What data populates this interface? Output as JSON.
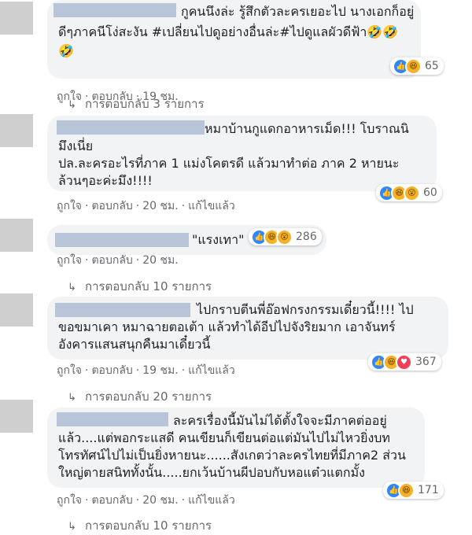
{
  "comments": [
    {
      "lines": [
        "กูคนนึงล่ะ รู้สึกตัวละครเยอะไป นางเอกก็อยู่",
        "ดีๆภาคนีโง่สะงัน #เปลี่ยนไปดูอย่างอื่นล่ะ#ไปดูแลผัวดีฟ้า🤣🤣",
        "🤣"
      ],
      "reaction_count": "65",
      "reactions": [
        "like-icon",
        "haha-icon"
      ],
      "like": "ถูกใจ",
      "reply": "ตอบกลับ",
      "time": "19 ชม.",
      "edited": "",
      "replies_label": "การตอบกลับ 3 รายการ"
    },
    {
      "lines": [
        "หมาบ้านกูแดกอาหารเม็ด!!! โบราณนิ",
        "มึงเนี่ย",
        "ปล.ละครอะไรที่ภาค 1 แม่งโคตรดี แล้วมาทำต่อ ภาค 2 หายนะ",
        "ล้วนๆอะค่ะมึง!!!!"
      ],
      "reaction_count": "60",
      "reactions": [
        "like-icon",
        "haha-icon",
        "wow-icon"
      ],
      "like": "ถูกใจ",
      "reply": "ตอบกลับ",
      "time": "20 ชม.",
      "edited": "แก้ไขแล้ว",
      "replies_label": ""
    },
    {
      "lines": [
        "\"แรงเทา\""
      ],
      "reaction_count": "286",
      "reactions": [
        "like-icon",
        "haha-icon",
        "wow-icon"
      ],
      "like": "ถูกใจ",
      "reply": "ตอบกลับ",
      "time": "20 ชม.",
      "edited": "",
      "replies_label": "การตอบกลับ 10 รายการ"
    },
    {
      "lines": [
        "ไปกราบตีนพี่อ๊อฟกรงกรรมเดี๋ยวนี้!!!! ไป",
        "ขอขมาเคา หมาฉายตอเต้า แล้วทำได้อีปไปจังริยมาก เอาจันทร์",
        "อังคารแสนสนุกคืนมาเดี๋ยวนี้"
      ],
      "reaction_count": "367",
      "reactions": [
        "like-icon",
        "haha-icon",
        "love-icon"
      ],
      "like": "ถูกใจ",
      "reply": "ตอบกลับ",
      "time": "19 ชม.",
      "edited": "แก้ไขแล้ว",
      "replies_label": "การตอบกลับ 20 รายการ"
    },
    {
      "lines": [
        "ละครเรื่องนี้มันไม่ได้ตั้งใจจะมีภาคต่ออยู่",
        "แล้ว....แต่พอกระแสดี คนเขียนก็เขียนต่อแต่มันไปไม่ไหวยิ่งบท",
        "โทรทัศน์ไปไม่เป็นยิ่งหายนะ......สังเกตว่าละครไทยที่มีภาค2 ส่วน",
        "ใหญ่ตายสนิททั้งนั้น.....ยกเว้นบ้านผีปอบกับหอแต๋วแตกมั้ง"
      ],
      "reaction_count": "171",
      "reactions": [
        "like-icon",
        "haha-icon"
      ],
      "like": "ถูกใจ",
      "reply": "ตอบกลับ",
      "time": "20 ชม.",
      "edited": "แก้ไขแล้ว",
      "replies_label": "การตอบกลับ 10 รายการ"
    }
  ]
}
